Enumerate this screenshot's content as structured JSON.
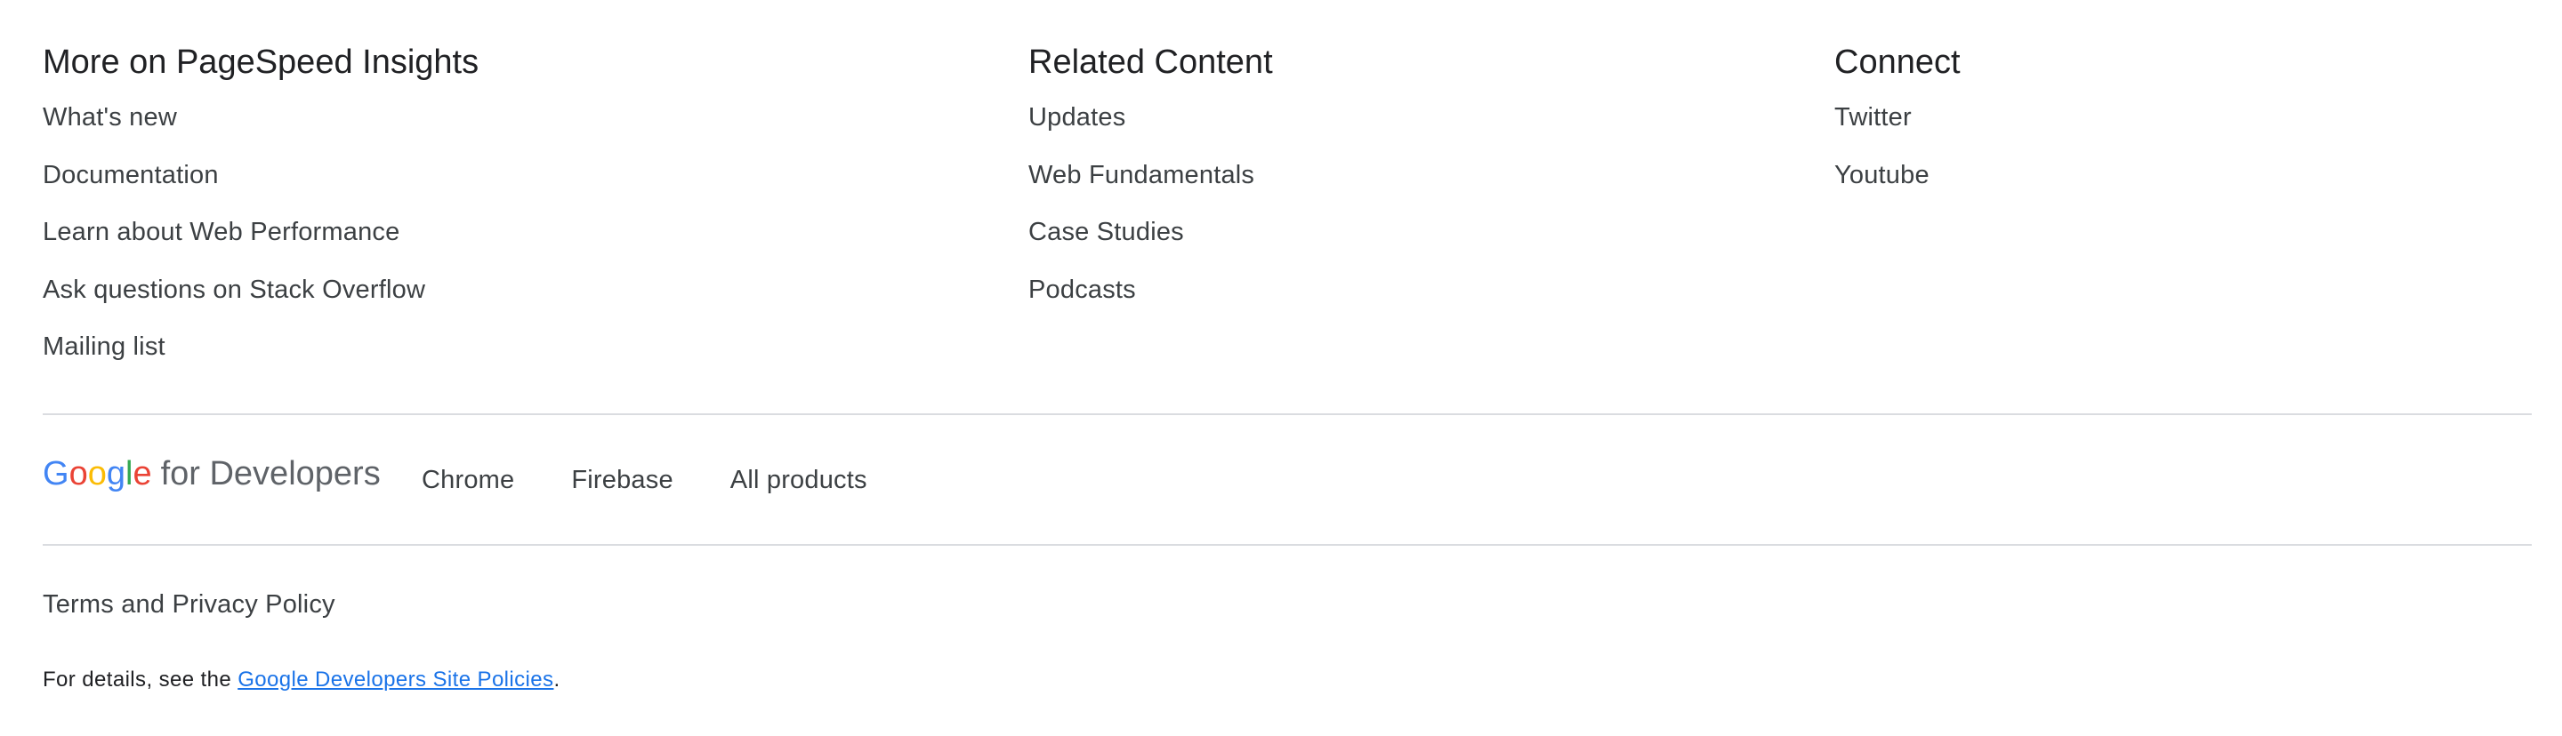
{
  "columns": [
    {
      "heading": "More on PageSpeed Insights",
      "links": [
        "What's new",
        "Documentation",
        "Learn about Web Performance",
        "Ask questions on Stack Overflow",
        "Mailing list"
      ]
    },
    {
      "heading": "Related Content",
      "links": [
        "Updates",
        "Web Fundamentals",
        "Case Studies",
        "Podcasts"
      ]
    },
    {
      "heading": "Connect",
      "links": [
        "Twitter",
        "Youtube"
      ]
    }
  ],
  "brand": {
    "logo_letters": [
      "G",
      "o",
      "o",
      "g",
      "l",
      "e"
    ],
    "suffix": "for Developers",
    "logo_colors": [
      "#4285f4",
      "#ea4335",
      "#fbbc05",
      "#4285f4",
      "#34a853",
      "#ea4335"
    ]
  },
  "products": [
    "Chrome",
    "Firebase",
    "All products"
  ],
  "terms": {
    "label": "Terms and Privacy Policy"
  },
  "details": {
    "prefix": "For details, see the ",
    "link_text": "Google Developers Site Policies",
    "suffix": "."
  },
  "colors": {
    "link": "#1a73e8",
    "text": "#3c4043",
    "divider": "#dadce0"
  }
}
